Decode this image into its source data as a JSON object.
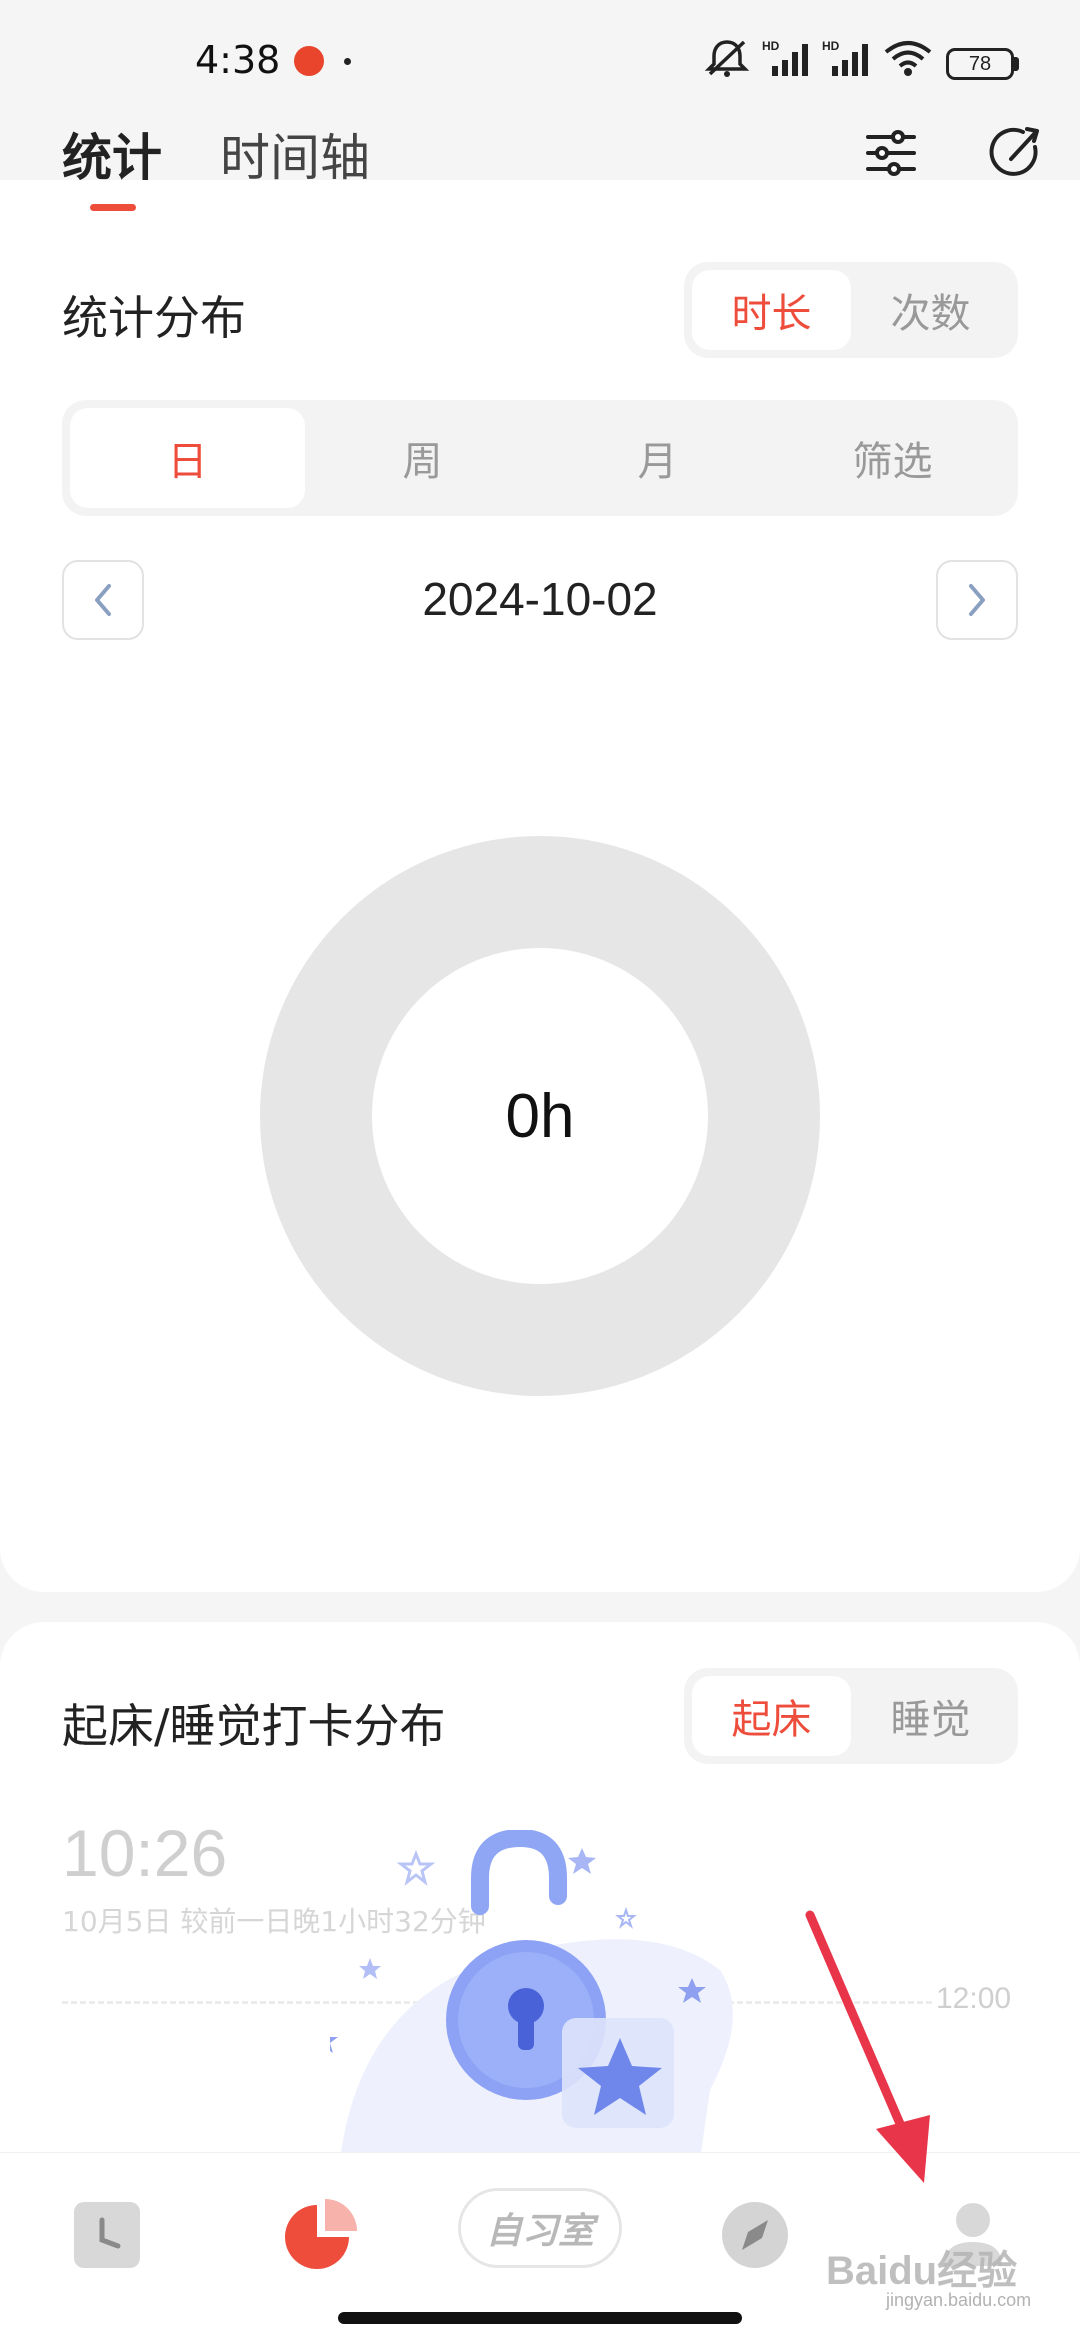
{
  "status_bar": {
    "time": "4:38",
    "battery": "78"
  },
  "header": {
    "tabs": [
      {
        "label": "统计",
        "active": true
      },
      {
        "label": "时间轴",
        "active": false
      }
    ]
  },
  "stats_section": {
    "title": "统计分布",
    "metric_toggle": [
      "时长",
      "次数"
    ],
    "metric_active": 0,
    "period_tabs": [
      "日",
      "周",
      "月",
      "筛选"
    ],
    "period_active": 0,
    "date": "2024-10-02",
    "total": "0h"
  },
  "checkin_section": {
    "title": "起床/睡觉打卡分布",
    "toggle": [
      "起床",
      "睡觉"
    ],
    "toggle_active": 0,
    "time": "10:26",
    "subtitle": "10月5日 较前一日晚1小时32分钟",
    "axis_label": "12:00"
  },
  "bottom_nav": {
    "study_room_label": "自习室"
  },
  "watermark": {
    "text": "Baidu经验",
    "sub": "jingyan.baidu.com"
  },
  "colors": {
    "accent": "#ee4d3c",
    "donut_track": "#e6e6e6",
    "arrow": "#e8354a"
  }
}
